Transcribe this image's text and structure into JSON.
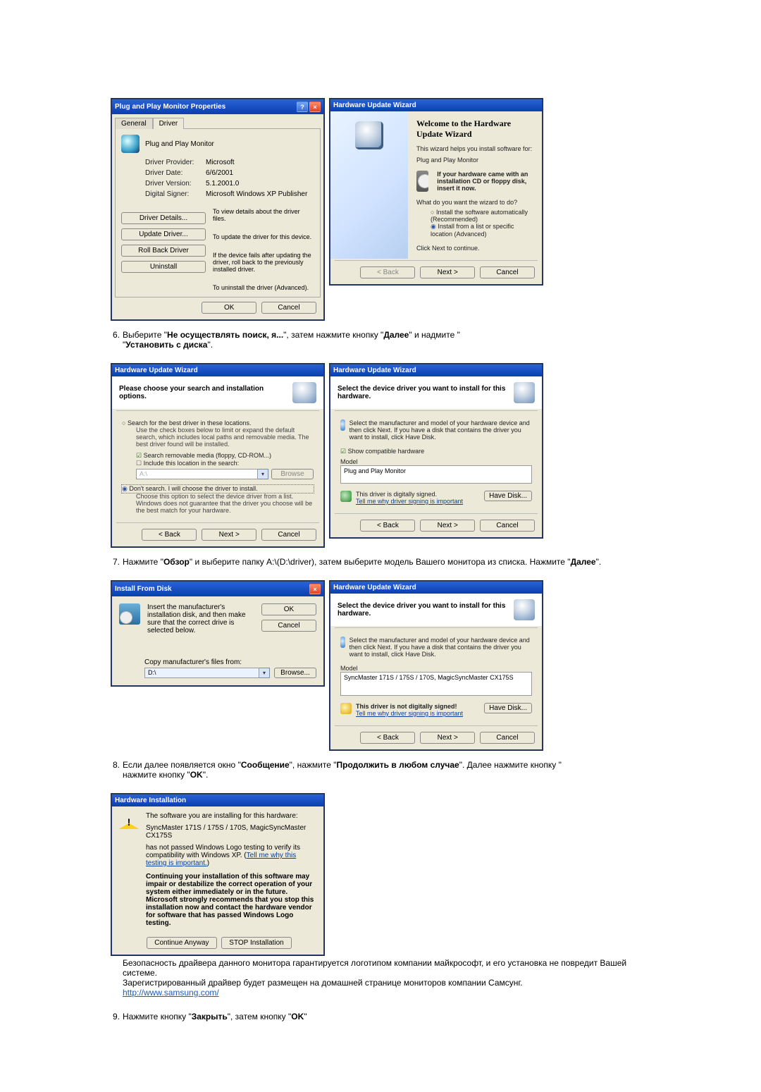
{
  "properties": {
    "title": "Plug and Play Monitor Properties",
    "tab_general": "General",
    "tab_driver": "Driver",
    "header": "Plug and Play Monitor",
    "rows": {
      "provider_l": "Driver Provider:",
      "provider_v": "Microsoft",
      "date_l": "Driver Date:",
      "date_v": "6/6/2001",
      "version_l": "Driver Version:",
      "version_v": "5.1.2001.0",
      "signer_l": "Digital Signer:",
      "signer_v": "Microsoft Windows XP Publisher"
    },
    "btns": {
      "details": "Driver Details...",
      "details_d": "To view details about the driver files.",
      "update": "Update Driver...",
      "update_d": "To update the driver for this device.",
      "rollback": "Roll Back Driver",
      "rollback_d": "If the device fails after updating the driver, roll back to the previously installed driver.",
      "uninstall": "Uninstall",
      "uninstall_d": "To uninstall the driver (Advanced)."
    },
    "ok": "OK",
    "cancel": "Cancel"
  },
  "wiz_welcome": {
    "title": "Hardware Update Wizard",
    "h": "Welcome to the Hardware Update Wizard",
    "p1": "This wizard helps you install software for:",
    "device": "Plug and Play Monitor",
    "cdnote": "If your hardware came with an installation CD or floppy disk, insert it now.",
    "q": "What do you want the wizard to do?",
    "opt_auto": "Install the software automatically (Recommended)",
    "opt_list": "Install from a list or specific location (Advanced)",
    "cont": "Click Next to continue.",
    "back": "< Back",
    "next": "Next >",
    "cancel": "Cancel"
  },
  "step6": {
    "pre": "Выберите \"",
    "b1": "Не осуществлять поиск, я...",
    "mid": "\", затем нажмите кнопку \"",
    "b2": "Далее",
    "post": "\" и надмите \"",
    "b3": "Установить с диска",
    "end": "\"."
  },
  "wiz_search": {
    "title": "Hardware Update Wizard",
    "hdr": "Please choose your search and installation options.",
    "opt_search": "Search for the best driver in these locations.",
    "opt_search_d": "Use the check boxes below to limit or expand the default search, which includes local paths and removable media. The best driver found will be installed.",
    "chk_media": "Search removable media (floppy, CD-ROM...)",
    "chk_loc": "Include this location in the search:",
    "loc": "A:\\",
    "browse": "Browse",
    "opt_dont": "Don't search. I will choose the driver to install.",
    "opt_dont_d": "Choose this option to select the device driver from a list. Windows does not guarantee that the driver you choose will be the best match for your hardware.",
    "back": "< Back",
    "next": "Next >",
    "cancel": "Cancel"
  },
  "wiz_select1": {
    "title": "Hardware Update Wizard",
    "hdr": "Select the device driver you want to install for this hardware.",
    "desc": "Select the manufacturer and model of your hardware device and then click Next. If you have a disk that contains the driver you want to install, click Have Disk.",
    "chk_compat": "Show compatible hardware",
    "model_l": "Model",
    "model_v": "Plug and Play Monitor",
    "signed": "This driver is digitally signed.",
    "tell": "Tell me why driver signing is important",
    "have": "Have Disk...",
    "back": "< Back",
    "next": "Next >",
    "cancel": "Cancel"
  },
  "step7": {
    "pre": "Нажмите \"",
    "b1": "Обзор",
    "mid1": "\" и выберите папку A:\\(D:\\driver), затем выберите модель Вашего монитора из списка. Нажмите \"",
    "b2": "Далее",
    "end": "\"."
  },
  "ifd": {
    "title": "Install From Disk",
    "p": "Insert the manufacturer's installation disk, and then make sure that the correct drive is selected below.",
    "ok": "OK",
    "cancel": "Cancel",
    "copy_l": "Copy manufacturer's files from:",
    "path": "D:\\",
    "browse": "Browse..."
  },
  "wiz_select2": {
    "title": "Hardware Update Wizard",
    "hdr": "Select the device driver you want to install for this hardware.",
    "desc": "Select the manufacturer and model of your hardware device and then click Next. If you have a disk that contains the driver you want to install, click Have Disk.",
    "model_l": "Model",
    "model_v": "SyncMaster 171S / 175S / 170S, MagicSyncMaster CX175S",
    "warn": "This driver is not digitally signed!",
    "tell": "Tell me why driver signing is important",
    "have": "Have Disk...",
    "back": "< Back",
    "next": "Next >",
    "cancel": "Cancel"
  },
  "step8": {
    "pre": "Если далее появляется окно \"",
    "b1": "Сообщение",
    "mid1": "\", нажмите \"",
    "b2": "Продолжить в любом случае",
    "mid2": "\". Далее нажмите кнопку \"",
    "b3": "OK",
    "end": "\"."
  },
  "hwi": {
    "title": "Hardware Installation",
    "p1": "The software you are installing for this hardware:",
    "dev": "SyncMaster 171S / 175S / 170S, MagicSyncMaster CX175S",
    "p2a": "has not passed Windows Logo testing to verify its compatibility with Windows XP. (",
    "p2link": "Tell me why this testing is important.",
    "p2b": ")",
    "p3": "Continuing your installation of this software may impair or destabilize the correct operation of your system either immediately or in the future. Microsoft strongly recommends that you stop this installation now and contact the hardware vendor for software that has passed Windows Logo testing.",
    "cont": "Continue Anyway",
    "stop": "STOP Installation"
  },
  "after8": {
    "l1": "Безопасность драйвера данного монитора гарантируется логотипом компании майкрософт, и его установка не повредит Вашей системе.",
    "l2": "Зарегистрированный драйвер будет размещен на домашней странице мониторов компании Самсунг.",
    "url": "http://www.samsung.com/"
  },
  "step9": {
    "pre": "Нажмите кнопку \"",
    "b1": "Закрыть",
    "mid": "\", затем кнопку \"",
    "b2": "OK",
    "end": "\""
  },
  "common": {
    "info_icon": "ℹ"
  }
}
